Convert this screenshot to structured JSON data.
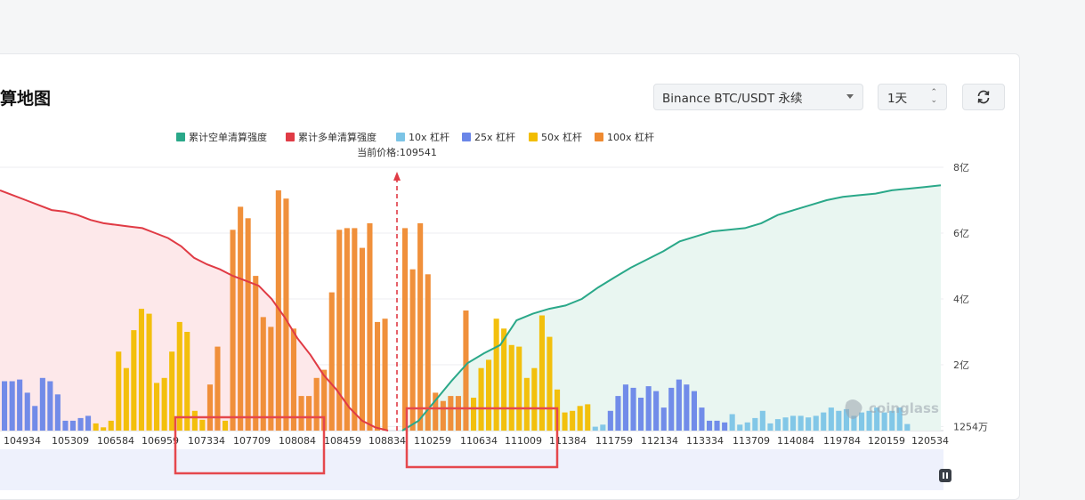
{
  "page": {
    "title": "算地图",
    "symbol_select": "Binance BTC/USDT 永续",
    "range_select": "1天",
    "icons": {
      "refresh": "refresh-icon",
      "dropdown": "chevron-down-icon",
      "stepper": "updown-icon",
      "pause": "pause-icon",
      "logo": "coinglass-logo"
    }
  },
  "chart_data": {
    "type": "bar",
    "legend_position": "top-center",
    "legend": [
      {
        "label": "累计空单清算强度",
        "color": "#2aa889"
      },
      {
        "label": "累计多单清算强度",
        "color": "#e03b45"
      },
      {
        "label": "10x 杠杆",
        "color": "#7cc4e6"
      },
      {
        "label": "25x 杠杆",
        "color": "#6a86e8"
      },
      {
        "label": "50x 杠杆",
        "color": "#f2bd00"
      },
      {
        "label": "100x 杠杆",
        "color": "#ef8a30"
      }
    ],
    "current_price_label": "当前价格:109541",
    "current_price": 109541,
    "watermark": "coinglass",
    "y_axis": {
      "ticks": [
        "8亿",
        "6亿",
        "4亿",
        "2亿",
        "1254万"
      ],
      "tick_values": [
        800000000,
        600000000,
        400000000,
        200000000,
        12540000
      ],
      "range": [
        12540000,
        800000000
      ]
    },
    "x_tick_labels": [
      "104934",
      "105309",
      "106584",
      "106959",
      "107334",
      "107709",
      "108084",
      "108459",
      "108834",
      "110259",
      "110634",
      "111009",
      "111384",
      "111759",
      "112134",
      "113334",
      "113709",
      "114084",
      "119784",
      "120159",
      "120534"
    ],
    "colors": {
      "short_fill": "#e9f6f1",
      "long_fill": "#fde8ea",
      "grid": "#eceef1",
      "price_line": "#e03b45",
      "highlight_box": "#e5484d"
    },
    "bars": [
      {
        "l": "25x",
        "v": 150
      },
      {
        "l": "25x",
        "v": 150
      },
      {
        "l": "25x",
        "v": 155
      },
      {
        "l": "25x",
        "v": 115
      },
      {
        "l": "25x",
        "v": 75
      },
      {
        "l": "25x",
        "v": 160
      },
      {
        "l": "25x",
        "v": 150
      },
      {
        "l": "25x",
        "v": 110
      },
      {
        "l": "25x",
        "v": 30
      },
      {
        "l": "25x",
        "v": 30
      },
      {
        "l": "25x",
        "v": 38
      },
      {
        "l": "25x",
        "v": 45
      },
      {
        "l": "50x",
        "v": 22
      },
      {
        "l": "50x",
        "v": 10
      },
      {
        "l": "50x",
        "v": 30
      },
      {
        "l": "50x",
        "v": 240
      },
      {
        "l": "50x",
        "v": 190
      },
      {
        "l": "50x",
        "v": 305
      },
      {
        "l": "50x",
        "v": 370
      },
      {
        "l": "50x",
        "v": 355
      },
      {
        "l": "50x",
        "v": 145
      },
      {
        "l": "50x",
        "v": 160
      },
      {
        "l": "50x",
        "v": 240
      },
      {
        "l": "50x",
        "v": 330
      },
      {
        "l": "50x",
        "v": 300
      },
      {
        "l": "50x",
        "v": 60
      },
      {
        "l": "50x",
        "v": 33
      },
      {
        "l": "100x",
        "v": 140
      },
      {
        "l": "100x",
        "v": 255
      },
      {
        "l": "50x",
        "v": 30
      },
      {
        "l": "100x",
        "v": 610
      },
      {
        "l": "100x",
        "v": 680
      },
      {
        "l": "100x",
        "v": 645
      },
      {
        "l": "100x",
        "v": 470
      },
      {
        "l": "100x",
        "v": 345
      },
      {
        "l": "100x",
        "v": 315
      },
      {
        "l": "100x",
        "v": 730
      },
      {
        "l": "100x",
        "v": 705
      },
      {
        "l": "100x",
        "v": 310
      },
      {
        "l": "100x",
        "v": 105
      },
      {
        "l": "100x",
        "v": 105
      },
      {
        "l": "100x",
        "v": 160
      },
      {
        "l": "100x",
        "v": 185
      },
      {
        "l": "100x",
        "v": 420
      },
      {
        "l": "100x",
        "v": 610
      },
      {
        "l": "100x",
        "v": 615
      },
      {
        "l": "100x",
        "v": 615
      },
      {
        "l": "100x",
        "v": 555
      },
      {
        "l": "100x",
        "v": 630
      },
      {
        "l": "100x",
        "v": 330
      },
      {
        "l": "100x",
        "v": 340
      },
      {
        "l": "100x",
        "v": 615
      },
      {
        "l": "100x",
        "v": 490
      },
      {
        "l": "100x",
        "v": 630
      },
      {
        "l": "100x",
        "v": 475
      },
      {
        "l": "100x",
        "v": 115
      },
      {
        "l": "100x",
        "v": 90
      },
      {
        "l": "100x",
        "v": 105
      },
      {
        "l": "100x",
        "v": 105
      },
      {
        "l": "100x",
        "v": 365
      },
      {
        "l": "50x",
        "v": 100
      },
      {
        "l": "50x",
        "v": 190
      },
      {
        "l": "50x",
        "v": 215
      },
      {
        "l": "50x",
        "v": 340
      },
      {
        "l": "50x",
        "v": 310
      },
      {
        "l": "50x",
        "v": 260
      },
      {
        "l": "50x",
        "v": 255
      },
      {
        "l": "50x",
        "v": 160
      },
      {
        "l": "50x",
        "v": 190
      },
      {
        "l": "50x",
        "v": 350
      },
      {
        "l": "50x",
        "v": 285
      },
      {
        "l": "50x",
        "v": 125
      },
      {
        "l": "50x",
        "v": 55
      },
      {
        "l": "50x",
        "v": 60
      },
      {
        "l": "50x",
        "v": 75
      },
      {
        "l": "50x",
        "v": 80
      },
      {
        "l": "10x",
        "v": 12
      },
      {
        "l": "10x",
        "v": 18
      },
      {
        "l": "25x",
        "v": 60
      },
      {
        "l": "25x",
        "v": 105
      },
      {
        "l": "25x",
        "v": 140
      },
      {
        "l": "25x",
        "v": 130
      },
      {
        "l": "25x",
        "v": 100
      },
      {
        "l": "25x",
        "v": 135
      },
      {
        "l": "25x",
        "v": 120
      },
      {
        "l": "25x",
        "v": 70
      },
      {
        "l": "25x",
        "v": 130
      },
      {
        "l": "25x",
        "v": 155
      },
      {
        "l": "25x",
        "v": 140
      },
      {
        "l": "25x",
        "v": 120
      },
      {
        "l": "25x",
        "v": 70
      },
      {
        "l": "25x",
        "v": 30
      },
      {
        "l": "25x",
        "v": 30
      },
      {
        "l": "25x",
        "v": 25
      },
      {
        "l": "10x",
        "v": 50
      },
      {
        "l": "10x",
        "v": 18
      },
      {
        "l": "10x",
        "v": 25
      },
      {
        "l": "10x",
        "v": 38
      },
      {
        "l": "10x",
        "v": 60
      },
      {
        "l": "10x",
        "v": 22
      },
      {
        "l": "10x",
        "v": 35
      },
      {
        "l": "10x",
        "v": 40
      },
      {
        "l": "10x",
        "v": 45
      },
      {
        "l": "10x",
        "v": 45
      },
      {
        "l": "10x",
        "v": 40
      },
      {
        "l": "10x",
        "v": 45
      },
      {
        "l": "10x",
        "v": 55
      },
      {
        "l": "10x",
        "v": 70
      },
      {
        "l": "10x",
        "v": 60
      },
      {
        "l": "10x",
        "v": 65
      },
      {
        "l": "10x",
        "v": 45
      },
      {
        "l": "10x",
        "v": 55
      },
      {
        "l": "10x",
        "v": 60
      },
      {
        "l": "10x",
        "v": 70
      },
      {
        "l": "10x",
        "v": 55
      },
      {
        "l": "10x",
        "v": 60
      },
      {
        "l": "10x",
        "v": 70
      },
      {
        "l": "10x",
        "v": 20
      }
    ],
    "long_cumulative": [
      730,
      715,
      700,
      685,
      670,
      665,
      655,
      640,
      630,
      625,
      620,
      615,
      600,
      585,
      560,
      525,
      505,
      490,
      470,
      455,
      440,
      400,
      345,
      280,
      230,
      170,
      125,
      70,
      30,
      10,
      0
    ],
    "short_cumulative": [
      0,
      30,
      90,
      150,
      205,
      235,
      260,
      335,
      355,
      370,
      380,
      400,
      435,
      465,
      495,
      520,
      545,
      575,
      590,
      605,
      610,
      615,
      630,
      655,
      670,
      685,
      700,
      710,
      715,
      720,
      730,
      735,
      740,
      745
    ]
  }
}
